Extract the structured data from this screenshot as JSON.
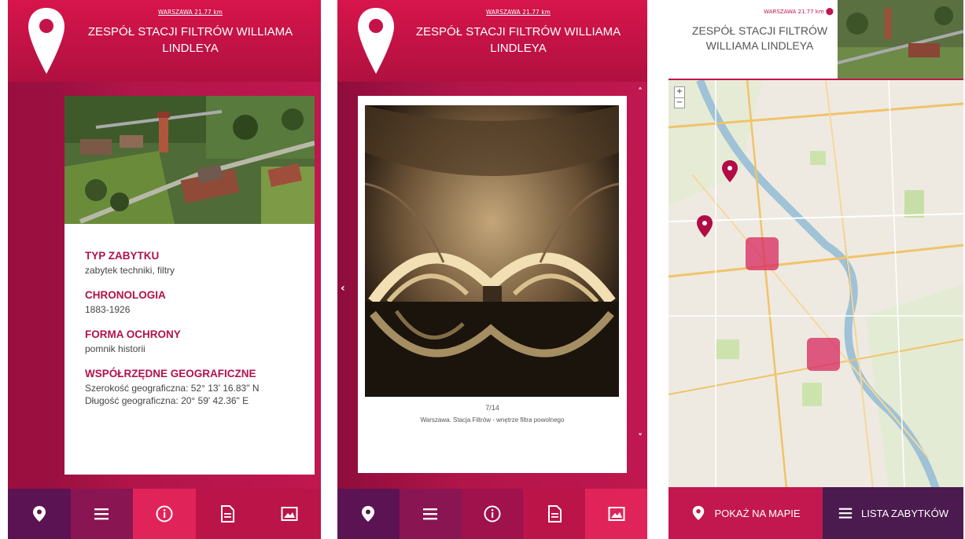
{
  "screens": [
    {
      "header": {
        "distance": "WARSZAWA 21.77 km",
        "title": "ZESPÓŁ STACJI FILTRÓW WILLIAMA LINDLEYA"
      },
      "details": [
        {
          "label": "TYP ZABYTKU",
          "value": "zabytek techniki, filtry"
        },
        {
          "label": "CHRONOLOGIA",
          "value": "1883-1926"
        },
        {
          "label": "FORMA OCHRONY",
          "value": "pomnik historii"
        },
        {
          "label": "WSPÓŁRZĘDNE GEOGRAFICZNE",
          "lines": [
            "Szerokość geograficzna: 52° 13' 16.83\" N",
            "Długość geograficzna: 20° 59' 42.36\" E"
          ]
        }
      ],
      "tabs": [
        {
          "icon": "map-pin-icon",
          "active": false
        },
        {
          "icon": "list-icon",
          "active": false
        },
        {
          "icon": "info-icon",
          "active": true
        },
        {
          "icon": "document-icon",
          "active": false
        },
        {
          "icon": "image-icon",
          "active": false
        }
      ]
    },
    {
      "header": {
        "distance": "WARSZAWA 21.77 km",
        "title": "ZESPÓŁ STACJI FILTRÓW WILLIAMA LINDLEYA"
      },
      "gallery": {
        "counter": "7/14",
        "caption": "Warszawa. Stacja Filtrów - wnętrze filtra powolnego"
      },
      "tabs": [
        {
          "icon": "map-pin-icon",
          "active": false
        },
        {
          "icon": "list-icon",
          "active": false
        },
        {
          "icon": "info-icon",
          "active": false
        },
        {
          "icon": "document-icon",
          "active": false
        },
        {
          "icon": "image-icon",
          "active": true
        }
      ]
    },
    {
      "header": {
        "distance": "WARSZAWA 21.77 km",
        "title": "ZESPÓŁ STACJI FILTRÓW WILLIAMA LINDLEYA"
      },
      "map": {
        "zoom_in": "+",
        "zoom_out": "−"
      },
      "buttons": {
        "show_on_map": "POKAŻ NA MAPIE",
        "list": "LISTA ZABYTKÓW"
      }
    }
  ],
  "colors": {
    "accent": "#c2184f",
    "purple": "#4b1a4e"
  }
}
